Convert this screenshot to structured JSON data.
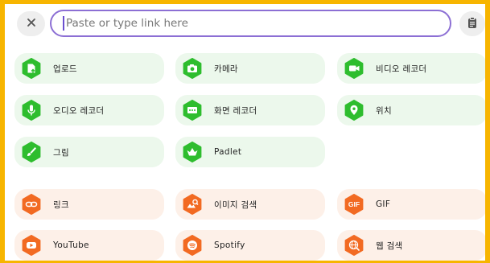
{
  "topbar": {
    "close_icon": "close-icon",
    "search_placeholder": "Paste or type link here",
    "clipboard_icon": "clipboard-icon"
  },
  "colors": {
    "frame": "#f7b500",
    "green_tile_bg": "#ecf8ec",
    "green_badge": "#2ebd2e",
    "orange_tile_bg": "#fdf0e8",
    "orange_badge": "#f26a22",
    "search_border": "#8c6fd4"
  },
  "options": {
    "upload": {
      "label": "업로드",
      "icon": "upload-file-icon"
    },
    "camera": {
      "label": "카메라",
      "icon": "camera-icon"
    },
    "video_recorder": {
      "label": "비디오 레코더",
      "icon": "video-camera-icon"
    },
    "audio_recorder": {
      "label": "오디오 레코더",
      "icon": "microphone-icon"
    },
    "screen_recorder": {
      "label": "화면 레코더",
      "icon": "screen-record-icon"
    },
    "location": {
      "label": "위치",
      "icon": "map-pin-icon"
    },
    "drawing": {
      "label": "그림",
      "icon": "brush-icon"
    },
    "padlet": {
      "label": "Padlet",
      "icon": "padlet-icon"
    },
    "link": {
      "label": "링크",
      "icon": "link-icon"
    },
    "image_search": {
      "label": "이미지 검색",
      "icon": "image-search-icon"
    },
    "gif": {
      "label": "GIF",
      "icon": "gif-icon",
      "badge_text": "GIF"
    },
    "youtube": {
      "label": "YouTube",
      "icon": "youtube-icon"
    },
    "spotify": {
      "label": "Spotify",
      "icon": "spotify-icon"
    },
    "web_search": {
      "label": "웹 검색",
      "icon": "globe-search-icon"
    }
  }
}
